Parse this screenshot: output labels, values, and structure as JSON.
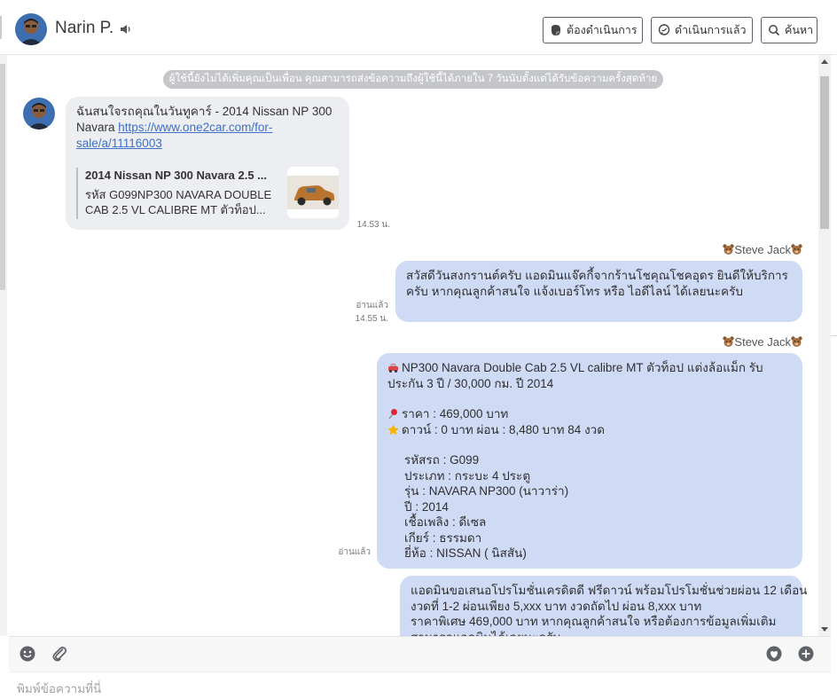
{
  "header": {
    "contact_name": "Narin P.",
    "buttons": {
      "todo": "ต้องดำเนินการ",
      "done": "ดำเนินการแล้ว",
      "search": "ค้นหา"
    }
  },
  "chat": {
    "system_notice": "ผู้ใช้นี้ยังไม่ได้เพิ่มคุณเป็นเพื่อน คุณสามารถส่งข้อความถึงผู้ใช้นี้ได้ภายใน 7 วันนับตั้งแต่ได้รับข้อความครั้งสุดท้าย",
    "incoming": {
      "text": "ฉันสนใจรถคุณในวันทูคาร์ - 2014 Nissan NP 300 Navara ",
      "link": "https://www.one2car.com/for-sale/a/11116003",
      "preview_title": "2014 Nissan NP 300 Navara 2.5 ...",
      "preview_desc": "รหัส G099NP300 NAVARA DOUBLE CAB 2.5 VL CALIBRE MT ตัวท็อป...",
      "time": "14.53 น."
    },
    "outgoing": [
      {
        "sender": "Steve Jack",
        "text": "สวัสดีวันสงกรานต์ครับ แอดมินแจ๊คกี้จากร้านโชคุณโชคอุดร ยินดีให้บริการครับ หากคุณลูกค้าสนใจ แจ้งเบอร์โทร หรือ ไอดีไลน์ ได้เลยนะครับ",
        "read": "อ่านแล้ว",
        "time": "14.55 น."
      },
      {
        "sender": "Steve Jack",
        "headline": "NP300 Navara Double Cab 2.5 VL calibre MT ตัวท็อป แต่งล้อแม็ก รับประกัน 3 ปี / 30,000 กม. ปี 2014",
        "price": "ราคา : 469,000 บาท",
        "down": "ดาวน์ : 0 บาท ผ่อน : 8,480 บาท 84 งวด",
        "specs": [
          "รหัสรถ : G099",
          "ประเภท : กระบะ 4 ประตู",
          "รุ่น : NAVARA NP300 (นาวาร่า)",
          "ปี : 2014",
          "เชื้อเพลิง : ดีเซล",
          "เกียร์ : ธรรมดา",
          "ยี่ห้อ : NISSAN ( นิสสัน)"
        ],
        "read": "อ่านแล้ว"
      },
      {
        "lines": [
          "แอดมินขอเสนอโปรโมชั่นเครดิตดี ฟรีดาวน์ พร้อมโปรโมชั่นช่วยผ่อน 12 เดือน",
          "งวดที่ 1-2 ผ่อนเพียง 5,xxx บาท งวดถัดไป ผ่อน 8,xxx บาท",
          "ราคาพิเศษ 469,000 บาท หากคุณลูกค้าสนใจ หรือต้องการข้อมูลเพิ่มเติม",
          "สามารถแอดมินได้เลยนะครับ"
        ]
      }
    ]
  },
  "composer": {
    "placeholder": "พิมพ์ข้อความที่นี่"
  },
  "colors": {
    "outgoing_bubble": "#cfdaf5",
    "incoming_bubble": "#eceef1",
    "link": "#3e70c6",
    "system_pill": "#c4c6ca"
  },
  "icons": [
    "speaker-icon",
    "sticker-icon",
    "chat-bubble-icon",
    "search-icon",
    "car-icon",
    "pin-icon",
    "star-icon",
    "bear-icon",
    "emoji-icon",
    "paperclip-icon",
    "more-icon"
  ]
}
